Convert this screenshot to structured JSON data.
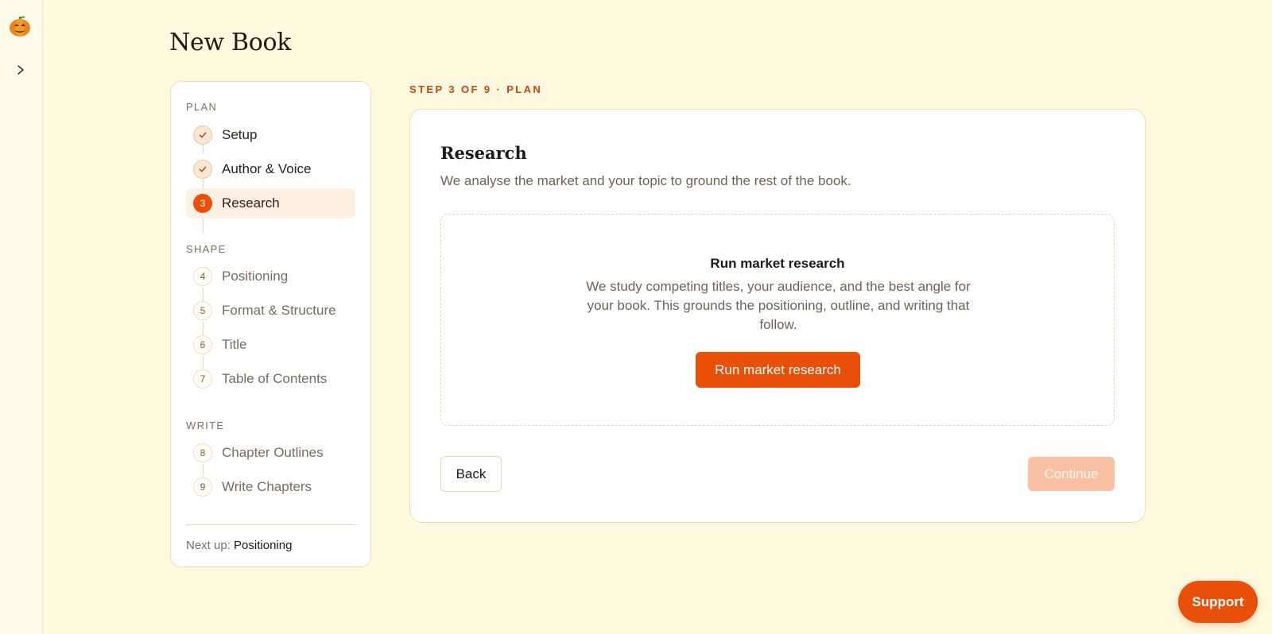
{
  "app": {
    "page_title": "New Book",
    "brand_colors": {
      "accent": "#e8500a",
      "background": "#fef8df"
    }
  },
  "rail": {
    "logo_icon": "pumpkin-logo-icon",
    "expand_icon": "chevron-right-icon"
  },
  "stepper": {
    "groups": [
      {
        "label": "PLAN",
        "steps": [
          {
            "label": "Setup",
            "status": "done",
            "marker": "check-icon"
          },
          {
            "label": "Author & Voice",
            "status": "done",
            "marker": "check-icon"
          },
          {
            "label": "Research",
            "status": "active",
            "number": "3"
          }
        ]
      },
      {
        "label": "SHAPE",
        "steps": [
          {
            "label": "Positioning",
            "status": "todo",
            "number": "4"
          },
          {
            "label": "Format & Structure",
            "status": "todo",
            "number": "5"
          },
          {
            "label": "Title",
            "status": "todo",
            "number": "6"
          },
          {
            "label": "Table of Contents",
            "status": "todo",
            "number": "7"
          }
        ]
      },
      {
        "label": "WRITE",
        "steps": [
          {
            "label": "Chapter Outlines",
            "status": "todo",
            "number": "8"
          },
          {
            "label": "Write Chapters",
            "status": "todo",
            "number": "9"
          }
        ]
      }
    ],
    "next_up_label": "Next up:",
    "next_up_value": "Positioning"
  },
  "main": {
    "step_indicator": "STEP 3 OF 9 · PLAN",
    "card": {
      "title": "Research",
      "subtitle": "We analyse the market and your topic to ground the rest of the book.",
      "empty_state": {
        "title": "Run market research",
        "description": "We study competing titles, your audience, and the best angle for your book. This grounds the positioning, outline, and writing that follow.",
        "button_label": "Run market research"
      },
      "back_label": "Back",
      "continue_label": "Continue"
    }
  },
  "support": {
    "label": "Support"
  }
}
